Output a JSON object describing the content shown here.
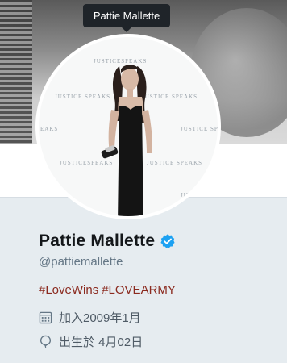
{
  "tooltip": {
    "text": "Pattie Mallette"
  },
  "avatar": {
    "watermark": [
      "JUSTICESPEAKS",
      "JUSTICE SPEAKS",
      "JUSTICE SPEAKS",
      "EAKS",
      "JUSTICE SPI",
      "JUSTICESPEAKS",
      "JUSTICE SPEAKS",
      "JU"
    ]
  },
  "profile": {
    "name": "Pattie Mallette",
    "handle": "@pattiemallette",
    "bio_tags": [
      "#LoveWins",
      "#LOVEARMY"
    ],
    "joined": "加入2009年1月",
    "birthday": "出生於 4月02日"
  },
  "colors": {
    "background": "#e6ecf0",
    "verified": "#1da1f2",
    "hashtag": "#8b2a1f",
    "tooltip": "#1f2429"
  },
  "icons": {
    "verified": "verified-badge-icon",
    "calendar": "calendar-icon",
    "birthday": "balloon-icon"
  }
}
